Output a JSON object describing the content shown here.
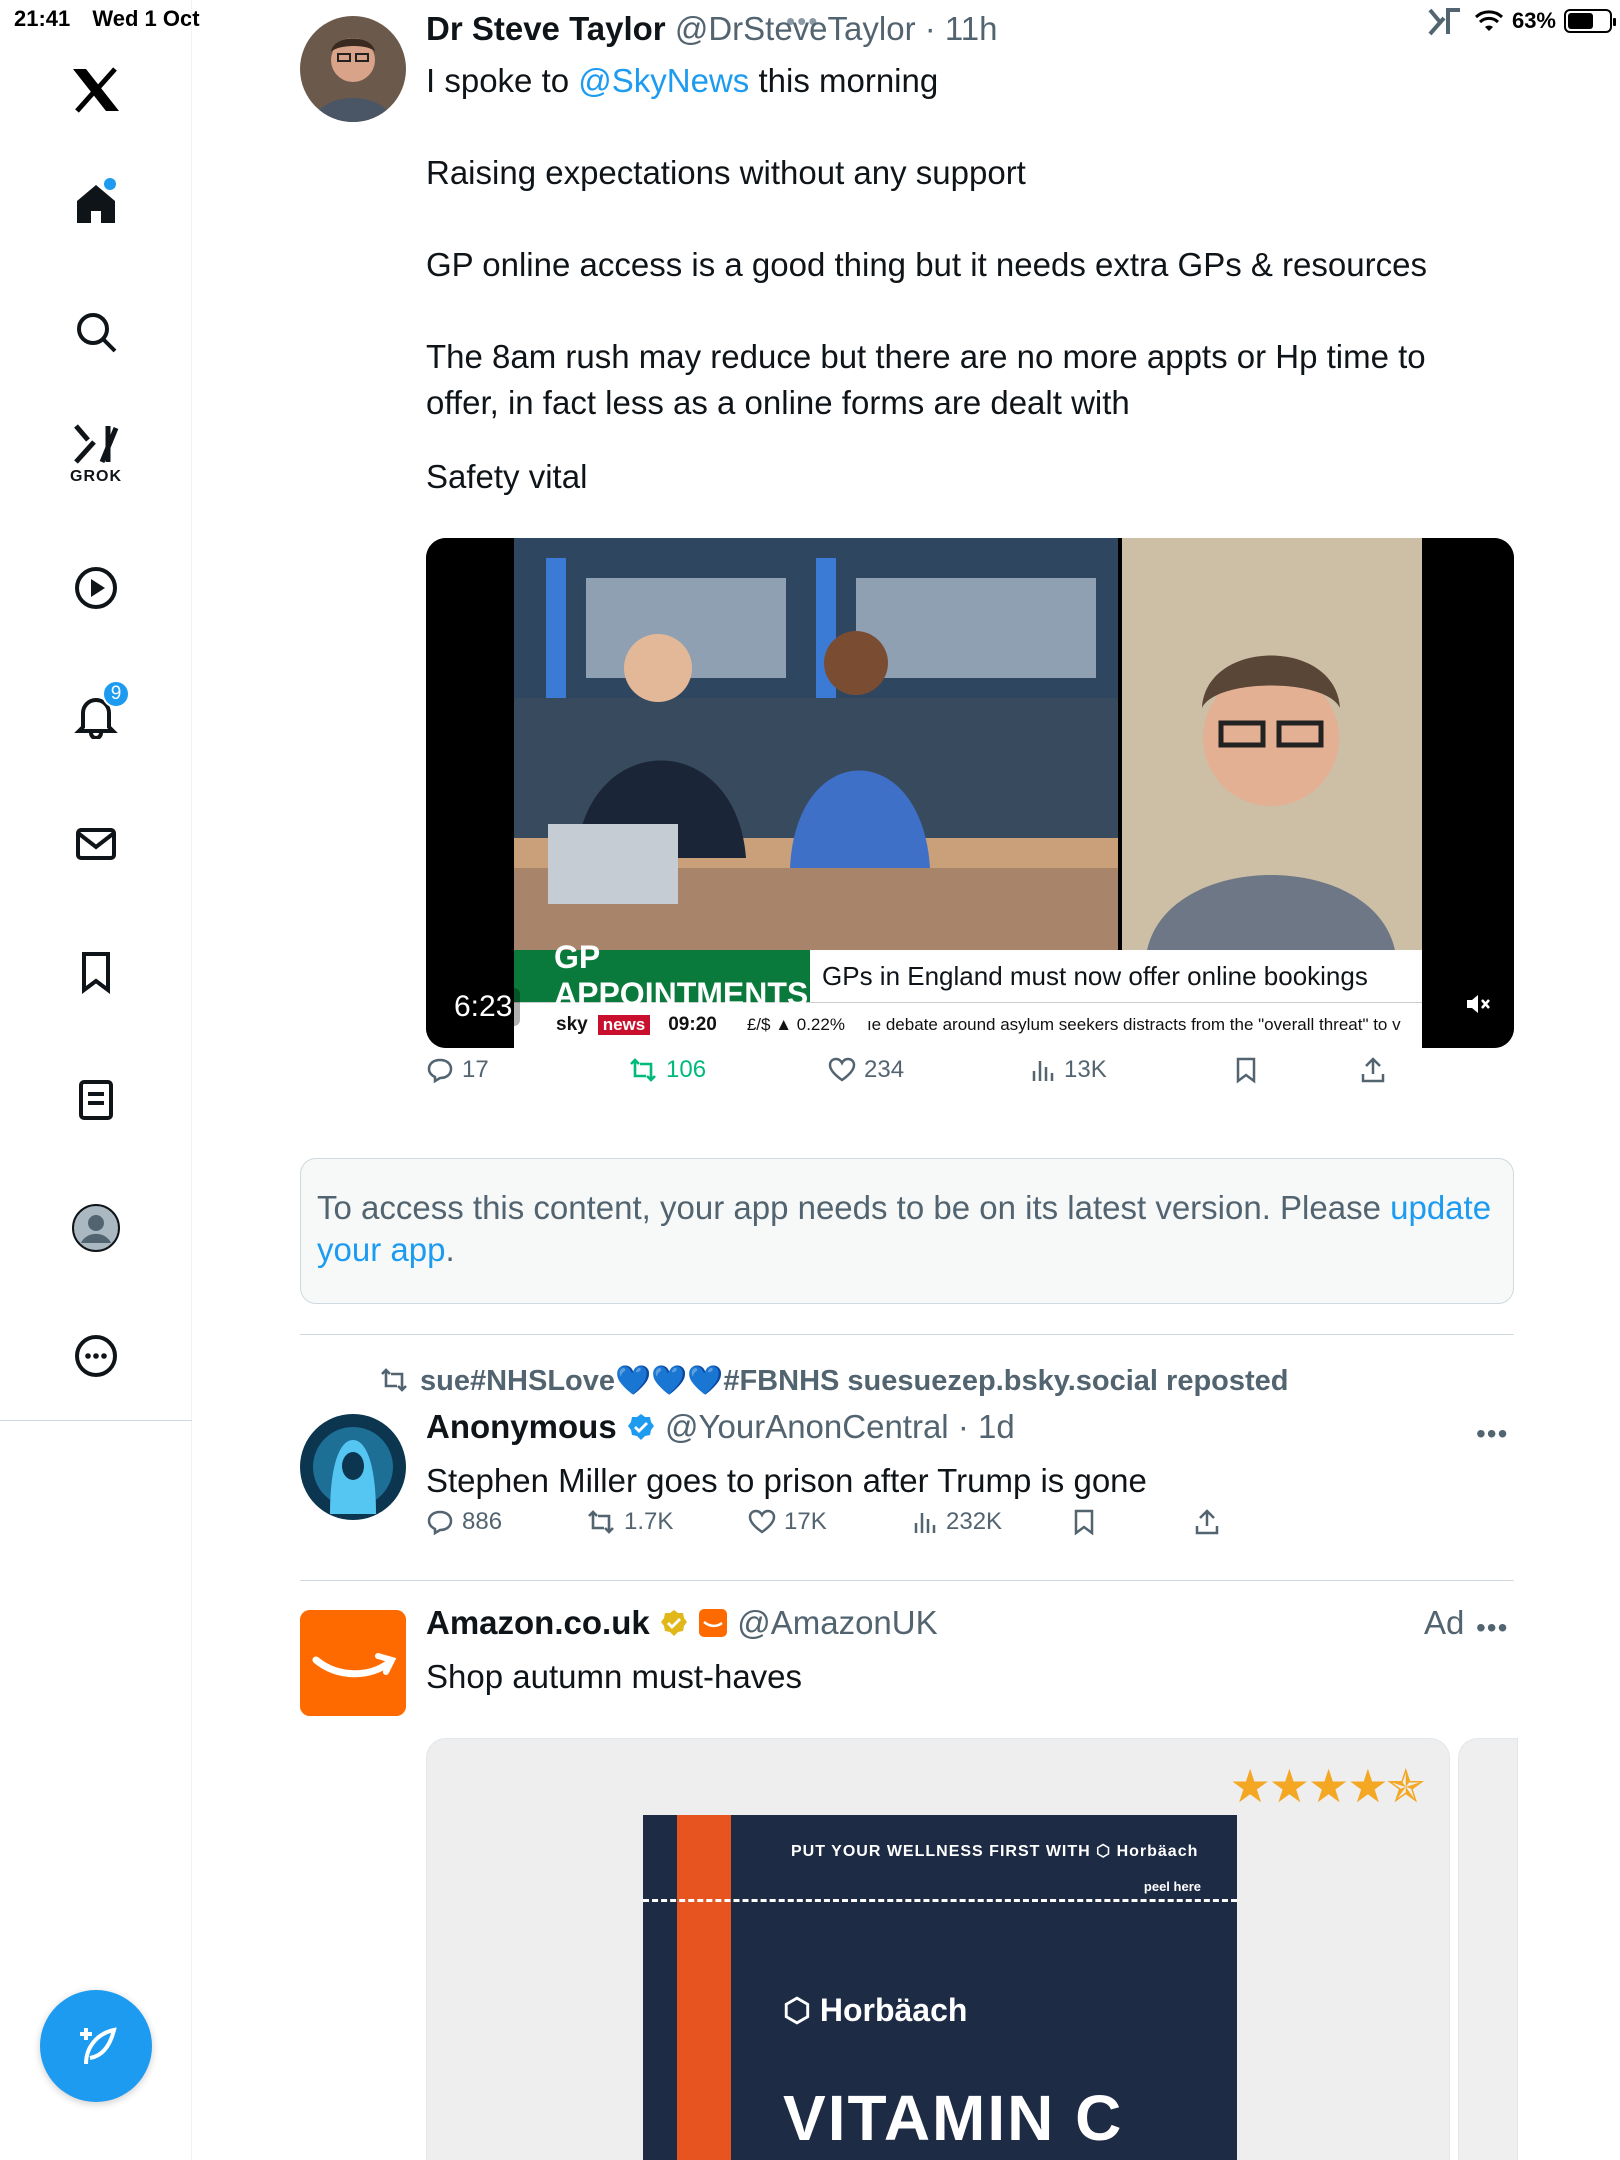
{
  "status_bar": {
    "time": "21:41",
    "date": "Wed 1 Oct",
    "battery": "63%",
    "battery_level": 0.63
  },
  "sidebar": {
    "grok_label": "GROK",
    "notifications_badge": "9"
  },
  "post1": {
    "name": "Dr Steve Taylor",
    "handle": "@DrSteveTaylor",
    "time": "· 11h",
    "line1_pre": "I spoke to ",
    "line1_mention": "@SkyNews",
    "line1_post": " this morning",
    "p2": "Raising expectations without any support",
    "p3": "GP online access is a good thing but it needs extra GPs & resources",
    "p4a": "The 8am rush may reduce but there are no more appts or Hp time to",
    "p4b": "offer, in fact less as a online forms are dealt with",
    "p5": "Safety vital",
    "video": {
      "duration": "6:23",
      "banner_title": "GP APPOINTMENTS",
      "banner_text": "GPs in England must now offer online bookings",
      "ticker_brand": "sky",
      "ticker_news": "news",
      "ticker_time": "09:20",
      "ticker_fx": "£/$ ▲ 0.22%",
      "ticker_text": "ıe debate around asylum seekers distracts from the \"overall threat\" to v"
    },
    "replies": "17",
    "reposts": "106",
    "likes": "234",
    "views": "13K"
  },
  "notice": {
    "text_a": "To access this content, your app needs to be on its latest version. Please",
    "link": "update your app",
    "text_b": "."
  },
  "post2": {
    "reposted_by": "sue#NHSLove💙💙💙#FBNHS suesuezep.bsky.social reposted",
    "name": "Anonymous",
    "handle": "@YourAnonCentral",
    "time": "· 1d",
    "text": "Stephen Miller goes to prison after Trump is gone",
    "replies": "886",
    "reposts": "1.7K",
    "likes": "17K",
    "views": "232K"
  },
  "post3": {
    "name": "Amazon.co.uk",
    "handle": "@AmazonUK",
    "ad": "Ad",
    "text": "Shop autumn must-haves",
    "product": {
      "top_text": "PUT YOUR WELLNESS FIRST WITH ⬡ Horbäach",
      "peel": "peel here",
      "brand": "⬡ Horbäach",
      "name": "VITAMIN C",
      "stars": "★★★★✯"
    }
  },
  "colors": {
    "accent": "#1d9bf0",
    "repost_green": "#00ba7c",
    "text_secondary": "#536471",
    "amazon": "#ff6a00"
  }
}
